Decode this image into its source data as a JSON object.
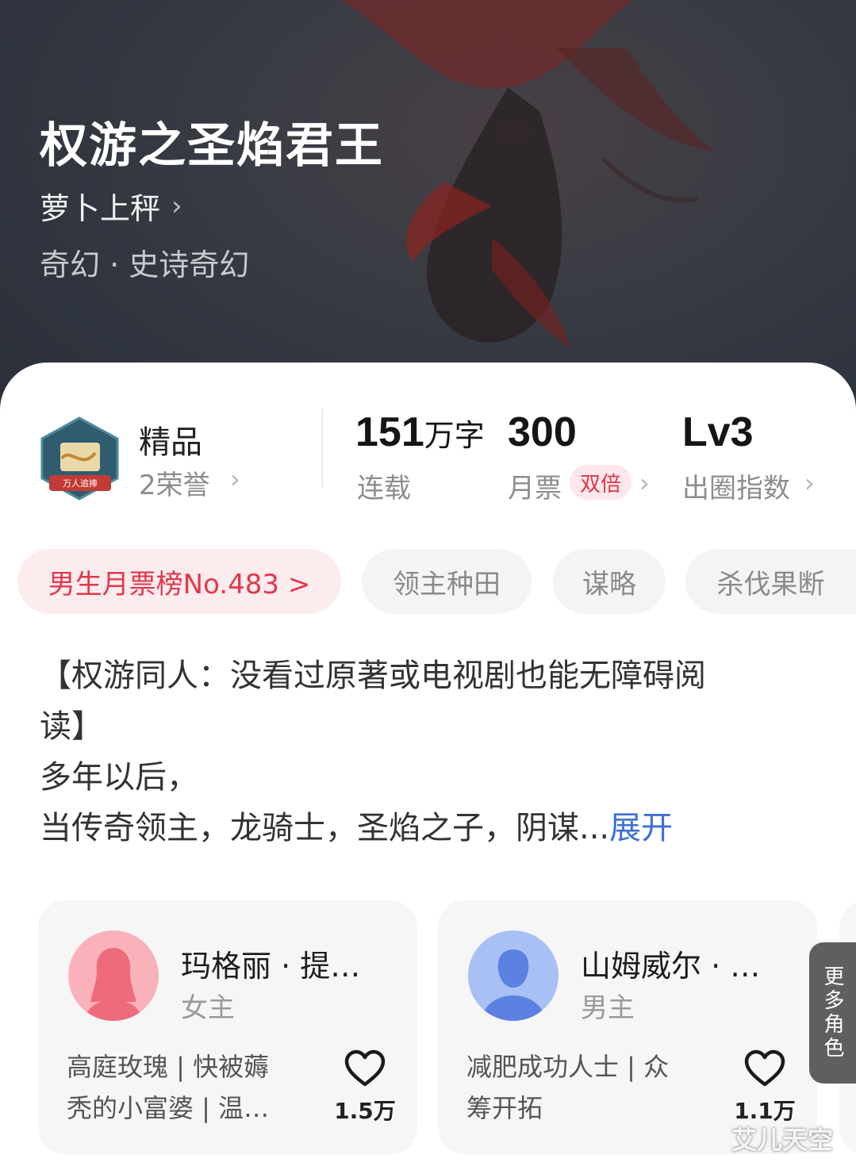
{
  "book": {
    "title": "权游之圣焰君王",
    "author": "萝卜上秤",
    "author_chevron": "›",
    "genre": "奇幻 · 史诗奇幻"
  },
  "stats": {
    "badge_title": "精品",
    "badge_sub": "2荣誉",
    "badge_logo_text": "万人追捧",
    "words_num": "151",
    "words_unit": "万字",
    "words_label": "连载",
    "tickets_num": "300",
    "tickets_label": "月票",
    "tickets_badge": "双倍",
    "level_num": "Lv3",
    "level_label": "出圈指数",
    "chevron": "›"
  },
  "tags": [
    {
      "label": "男生月票榜No.483 >"
    },
    {
      "label": "领主种田"
    },
    {
      "label": "谋略"
    },
    {
      "label": "杀伐果断"
    }
  ],
  "synopsis": {
    "line1": "【权游同人：没看过原著或电视剧也能无障碍阅",
    "line2": "读】",
    "line3": "多年以后，",
    "line4": "当传奇领主，龙骑士，圣焰之子，阴谋...",
    "expand": "展开"
  },
  "characters": [
    {
      "name": "玛格丽 · 提…",
      "role": "女主",
      "desc1": "高庭玫瑰 | 快被薅",
      "desc2": "秃的小富婆 | 温…",
      "likes": "1.5万",
      "avatar_color": "#f07f8c"
    },
    {
      "name": "山姆威尔 · …",
      "role": "男主",
      "desc1": "减肥成功人士 | 众",
      "desc2": "筹开拓",
      "likes": "1.1万",
      "avatar_color": "#6f93e6"
    }
  ],
  "more_roles": "更多角色",
  "watermark": "艾儿天空",
  "colors": {
    "accent_red": "#e2384c",
    "link_blue": "#3d6fd6",
    "hero_bg": "#2f343e"
  },
  "icons": [
    "chevron-right-icon",
    "heart-icon",
    "honor-badge-icon"
  ]
}
